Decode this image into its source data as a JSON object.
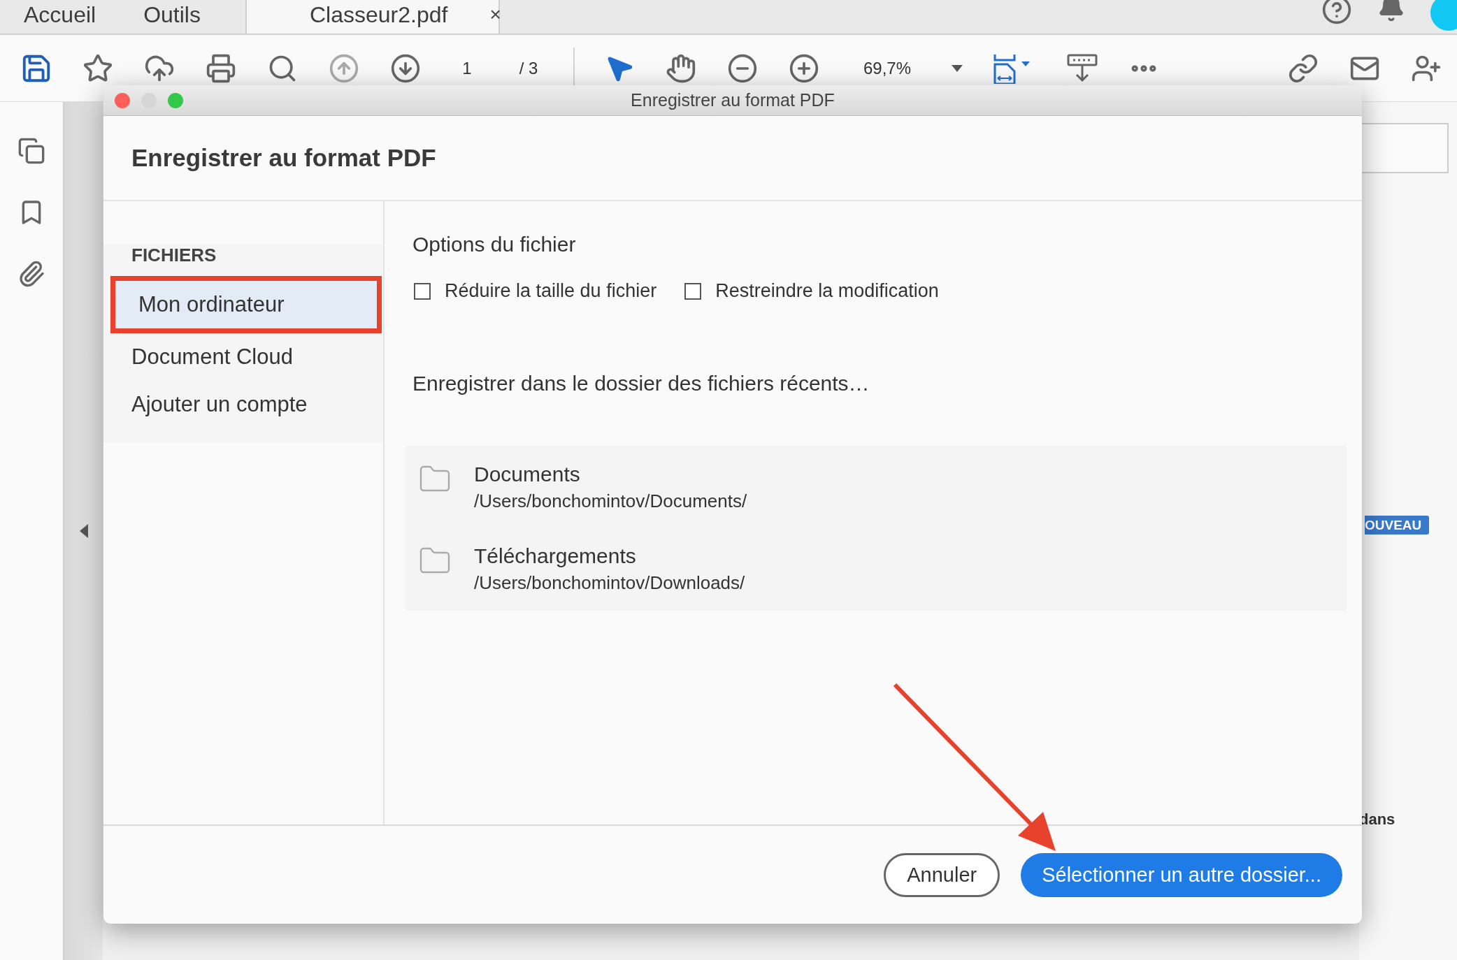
{
  "tabs": [
    {
      "label": "Accueil",
      "selected": false
    },
    {
      "label": "Outils",
      "selected": false
    },
    {
      "label": "Classeur2.pdf",
      "selected": true,
      "close": "×"
    }
  ],
  "toolbar": {
    "page_current": "1",
    "page_total": "/ 3",
    "zoom": "69,7%"
  },
  "dialog": {
    "window_title": "Enregistrer au format PDF",
    "heading": "Enregistrer au format PDF",
    "sidebar": {
      "section": "FICHIERS",
      "items": [
        {
          "label": "Mon ordinateur",
          "selected": true,
          "annotated": true
        },
        {
          "label": "Document Cloud",
          "selected": false,
          "annotated": false
        },
        {
          "label": "Ajouter un compte",
          "selected": false,
          "annotated": false
        }
      ]
    },
    "options_title": "Options du fichier",
    "options": [
      {
        "label": "Réduire la taille du fichier",
        "checked": false
      },
      {
        "label": "Restreindre la modification",
        "checked": false
      }
    ],
    "recent_title": "Enregistrer dans le dossier des fichiers récents…",
    "recent": [
      {
        "name": "Documents",
        "path": "/Users/bonchomintov/Documents/"
      },
      {
        "name": "Téléchargements",
        "path": "/Users/bonchomintov/Downloads/"
      }
    ],
    "buttons": [
      {
        "label": "Annuler",
        "kind": "secondary"
      },
      {
        "label": "Sélectionner un autre dossier...",
        "kind": "primary"
      }
    ]
  },
  "background": {
    "badge": "OUVEAU",
    "text": "dans"
  },
  "annotation_arrow": true
}
